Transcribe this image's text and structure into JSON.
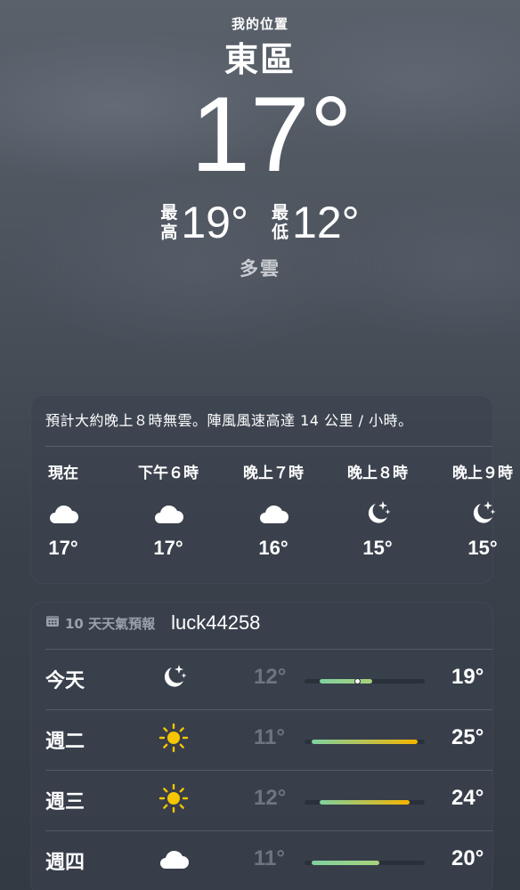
{
  "location": {
    "label": "我的位置",
    "name": "東區"
  },
  "current": {
    "temp": "17°",
    "high_label_top": "最",
    "high_label_bottom": "高",
    "high": "19°",
    "low_label_top": "最",
    "low_label_bottom": "低",
    "low": "12°",
    "condition": "多雲"
  },
  "hourly": {
    "summary": "預計大約晚上８時無雲。陣風風速高達 14 公里 / 小時。",
    "items": [
      {
        "label": "現在",
        "icon": "cloud-icon",
        "temp": "17°"
      },
      {
        "label": "下午６時",
        "icon": "cloud-icon",
        "temp": "17°"
      },
      {
        "label": "晚上７時",
        "icon": "cloud-icon",
        "temp": "16°"
      },
      {
        "label": "晚上８時",
        "icon": "moon-stars-icon",
        "temp": "15°"
      },
      {
        "label": "晚上９時",
        "icon": "moon-stars-icon",
        "temp": "15°"
      }
    ]
  },
  "daily": {
    "icon": "calendar-icon",
    "title": "10 天天氣預報",
    "overlay_text": "luck44258",
    "days": [
      {
        "day": "今天",
        "icon": "moon-stars-icon",
        "low": "12°",
        "high": "19°",
        "current_marker": 17
      },
      {
        "day": "週二",
        "icon": "sun-icon",
        "low": "11°",
        "high": "25°"
      },
      {
        "day": "週三",
        "icon": "sun-icon",
        "low": "12°",
        "high": "24°"
      },
      {
        "day": "週四",
        "icon": "cloud-icon",
        "low": "11°",
        "high": "20°"
      }
    ]
  },
  "colors": {
    "bar_cool": "#7fd1a0",
    "bar_warm": "#f5b400",
    "sun": "#f7c600"
  }
}
